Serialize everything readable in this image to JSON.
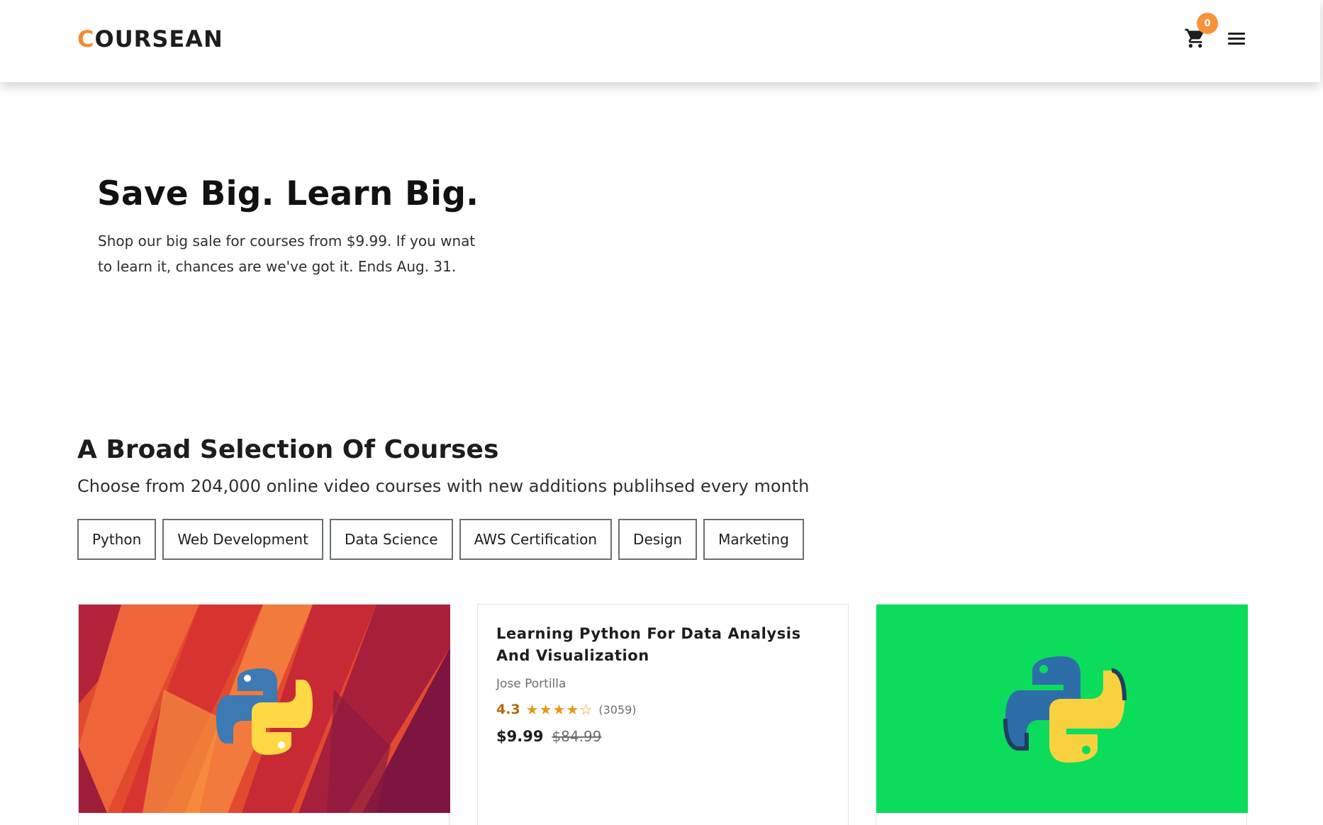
{
  "header": {
    "logo_accent": "C",
    "logo_rest": "OURSEAN",
    "cart_count": "0"
  },
  "hero": {
    "title": "Save Big. Learn Big.",
    "text": "Shop our big sale for courses from $9.99. If you wnat to learn it, chances are we've got it. Ends Aug. 31."
  },
  "section": {
    "title": "A Broad Selection Of Courses",
    "subtitle": "Choose from 204,000 online video courses with new additions publihsed every month",
    "tabs": [
      "Python",
      "Web Development",
      "Data Science",
      "AWS Certification",
      "Design",
      "Marketing"
    ]
  },
  "courses": [
    {
      "image": "python-logo-red-pattern"
    },
    {
      "title": "Learning Python For Data Analysis And Visualization",
      "instructor": "Jose Portilla",
      "rating": "4.3",
      "stars": "★★★★☆",
      "reviews": "(3059)",
      "price": "$9.99",
      "old_price": "$84.99"
    },
    {
      "image": "python-logo-green"
    }
  ],
  "colors": {
    "accent": "#f28c38",
    "badge": "#f7933b",
    "star": "#e59819",
    "green_card": "#0bdc5c"
  }
}
